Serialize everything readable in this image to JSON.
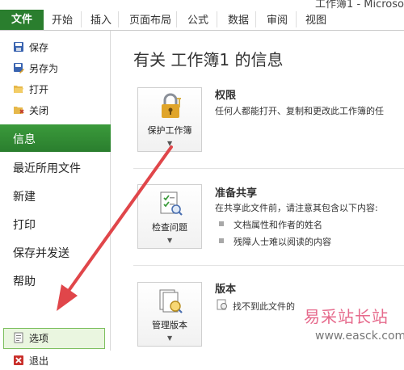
{
  "window": {
    "title": "工作簿1 - Microso"
  },
  "ribbon": {
    "file_tab": "文件",
    "tabs": [
      "开始",
      "插入",
      "页面布局",
      "公式",
      "数据",
      "审阅",
      "视图"
    ]
  },
  "nav": {
    "save": "保存",
    "save_as": "另存为",
    "open": "打开",
    "close": "关闭",
    "info": "信息",
    "recent": "最近所用文件",
    "new": "新建",
    "print": "打印",
    "save_send": "保存并发送",
    "help": "帮助",
    "options": "选项",
    "exit": "退出"
  },
  "main": {
    "title": "有关 工作簿1 的信息",
    "permissions": {
      "button_label": "保护工作簿",
      "heading": "权限",
      "text": "任何人都能打开、复制和更改此工作簿的任"
    },
    "prepare": {
      "button_label": "检查问题",
      "heading": "准备共享",
      "text": "在共享此文件前，请注意其包含以下内容:",
      "bullets": [
        "文档属性和作者的姓名",
        "残障人士难以阅读的内容"
      ]
    },
    "versions": {
      "button_label": "管理版本",
      "heading": "版本",
      "text": "找不到此文件的"
    }
  },
  "watermark": {
    "text": "易采站长站",
    "url": "www.easck.com"
  },
  "colors": {
    "accent": "#2a7e2e",
    "arrow": "#e0464a",
    "watermark": "#e66a8c"
  }
}
